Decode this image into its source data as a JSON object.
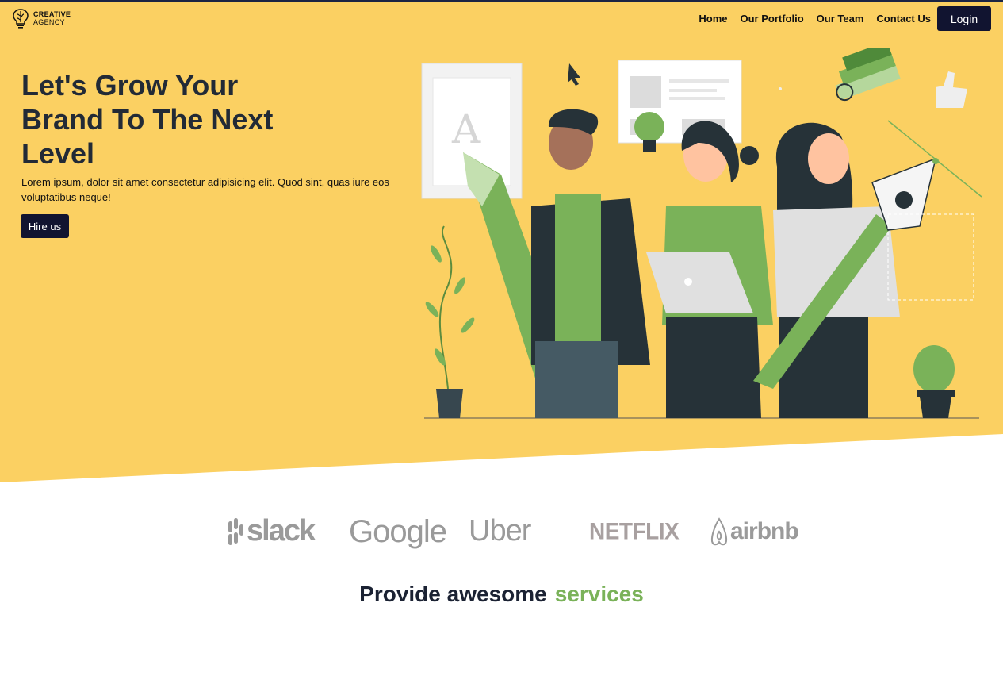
{
  "brand": {
    "line1": "CREATIVE",
    "line2": "AGENCY"
  },
  "nav": {
    "items": [
      "Home",
      "Our Portfolio",
      "Our Team",
      "Contact Us"
    ],
    "login_label": "Login"
  },
  "hero": {
    "title": "Let's Grow Your Brand To The Next Level",
    "description": "Lorem ipsum, dolor sit amet consectetur adipisicing elit. Quod sint, quas iure eos voluptatibus neque!",
    "cta_label": "Hire us"
  },
  "clients": {
    "logos": [
      "slack",
      "Google",
      "Uber",
      "NETFLIX",
      "airbnb"
    ]
  },
  "services": {
    "title_part1": "Provide awesome",
    "title_part2": "services"
  },
  "colors": {
    "hero_bg": "#fbd062",
    "button_bg": "#111430",
    "accent": "#7ab259",
    "logo_gray": "#9a9a9a"
  }
}
